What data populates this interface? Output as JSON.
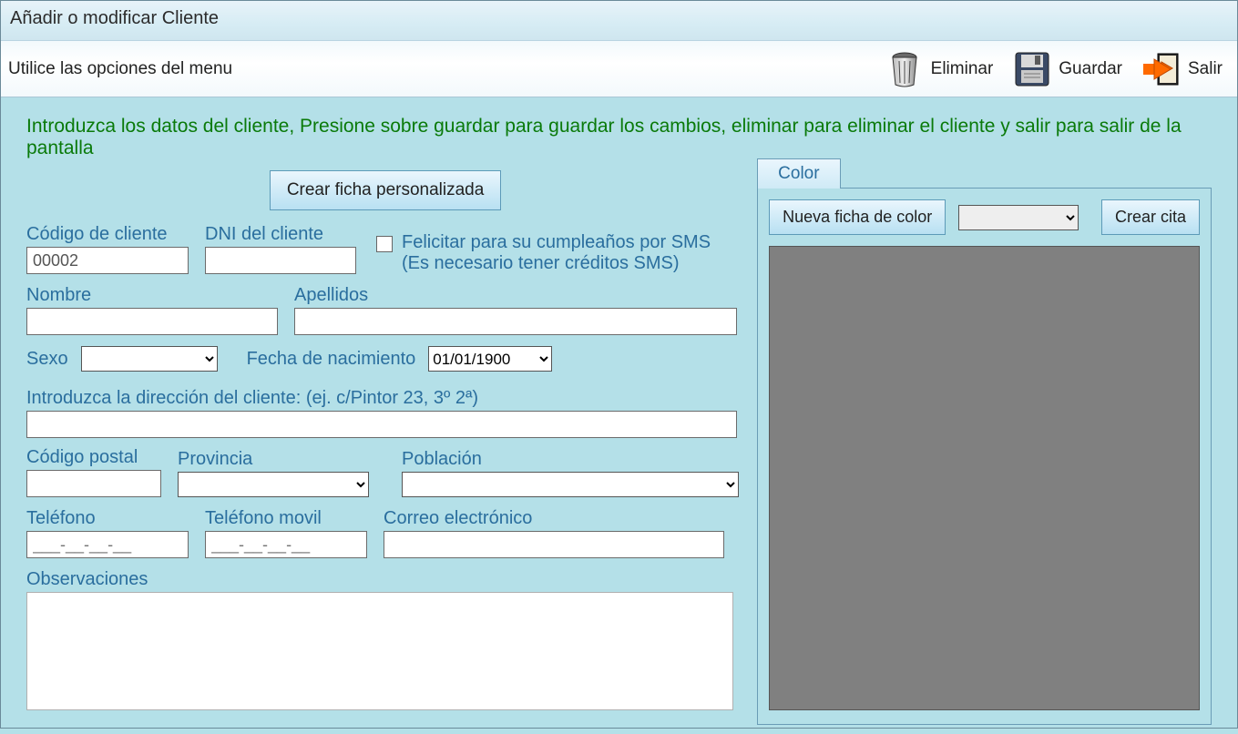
{
  "window": {
    "title": "Añadir o modificar Cliente"
  },
  "toolbar": {
    "hint": "Utilice las opciones del menu",
    "delete": "Eliminar",
    "save": "Guardar",
    "exit": "Salir"
  },
  "instruction": "Introduzca los datos del cliente, Presione sobre guardar para guardar los cambios, eliminar para eliminar el cliente y salir para salir de la pantalla",
  "buttons": {
    "crear_ficha_personalizada": "Crear ficha personalizada",
    "nueva_ficha_color": "Nueva ficha de color",
    "crear_cita": "Crear cita"
  },
  "labels": {
    "codigo_cliente": "Código de cliente",
    "dni": "DNI del cliente",
    "sms_checkbox": "Felicitar para su cumpleaños por SMS (Es necesario tener créditos SMS)",
    "nombre": "Nombre",
    "apellidos": "Apellidos",
    "sexo": "Sexo",
    "fecha_nacimiento": "Fecha de nacimiento",
    "direccion": "Introduzca la dirección del cliente: (ej. c/Pintor 23, 3º 2ª)",
    "codigo_postal": "Código postal",
    "provincia": "Provincia",
    "poblacion": "Población",
    "telefono": "Teléfono",
    "telefono_movil": "Teléfono movil",
    "correo": "Correo electrónico",
    "observaciones": "Observaciones",
    "tab_color": "Color"
  },
  "values": {
    "codigo_cliente": "00002",
    "dni": "",
    "nombre": "",
    "apellidos": "",
    "sexo": "",
    "fecha_nacimiento": "01/01/1900",
    "direccion": "",
    "codigo_postal": "",
    "provincia": "",
    "poblacion": "",
    "telefono": "___-__-__-__",
    "telefono_movil": "___-__-__-__",
    "correo": "",
    "observaciones": "",
    "color_select": ""
  }
}
